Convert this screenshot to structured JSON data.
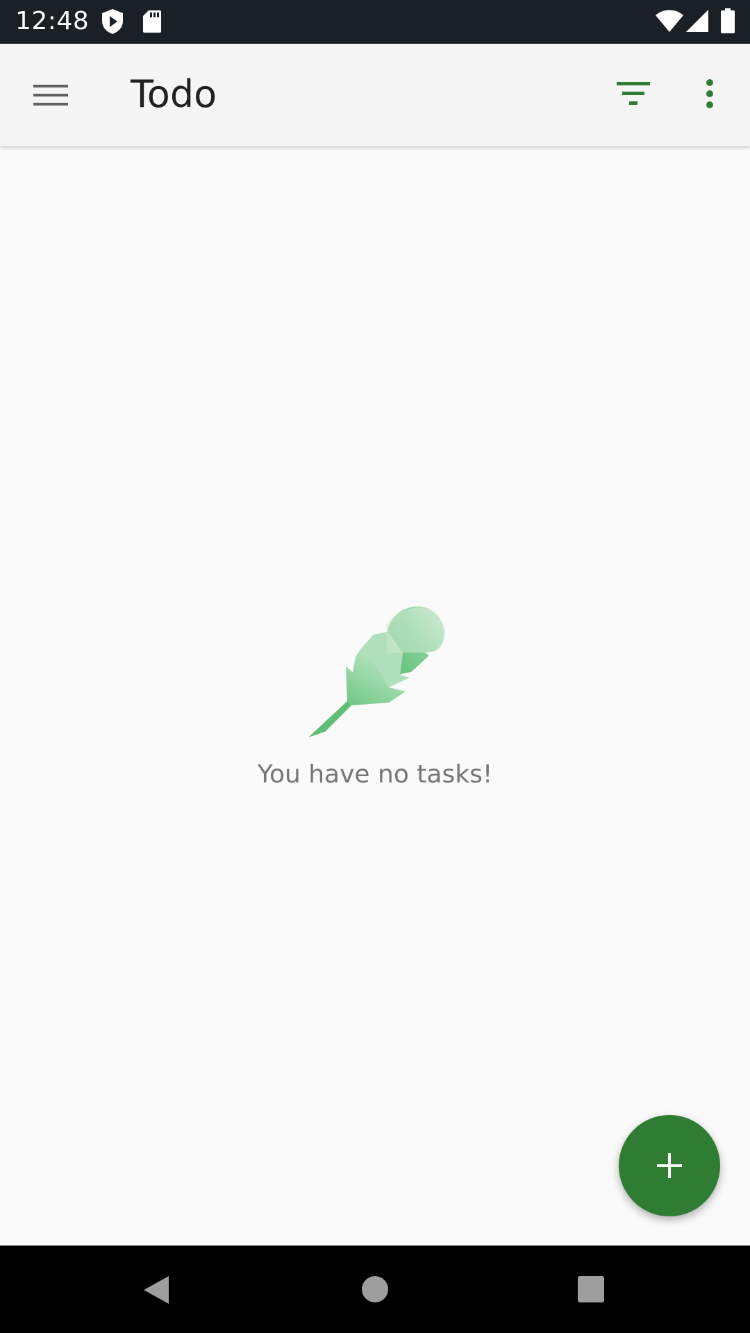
{
  "status_bar": {
    "time": "12:48",
    "icons": [
      "play-protect-icon",
      "sd-card-icon",
      "wifi-icon",
      "cell-signal-icon",
      "battery-icon"
    ]
  },
  "app_bar": {
    "title": "Todo",
    "icons": [
      "menu-icon",
      "filter-icon",
      "more-vert-icon"
    ],
    "accent_color": "#2e7d32"
  },
  "empty_state": {
    "icon": "feather-icon",
    "message": "You have no tasks!"
  },
  "fab": {
    "icon": "plus-icon",
    "color": "#2e7d32"
  },
  "nav_bar": {
    "icons": [
      "back-icon",
      "home-icon",
      "recents-icon"
    ]
  }
}
